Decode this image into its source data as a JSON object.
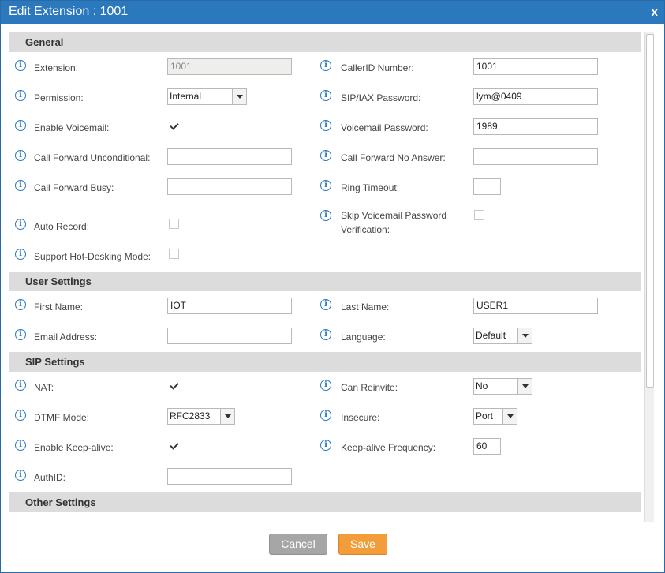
{
  "dialog": {
    "title": "Edit Extension : 1001",
    "close_label": "x"
  },
  "sections": {
    "general": "General",
    "user_settings": "User Settings",
    "sip_settings": "SIP Settings",
    "other_settings": "Other Settings"
  },
  "general": {
    "extension": {
      "label": "Extension:",
      "value": "1001"
    },
    "callerid_number": {
      "label": "CallerID Number:",
      "value": "1001"
    },
    "permission": {
      "label": "Permission:",
      "value": "Internal"
    },
    "sip_iax_password": {
      "label": "SIP/IAX Password:",
      "value": "lym@0409"
    },
    "enable_voicemail": {
      "label": "Enable Voicemail:",
      "checked": true
    },
    "voicemail_password": {
      "label": "Voicemail Password:",
      "value": "1989"
    },
    "cf_unconditional": {
      "label": "Call Forward Unconditional:",
      "value": ""
    },
    "cf_no_answer": {
      "label": "Call Forward No Answer:",
      "value": ""
    },
    "cf_busy": {
      "label": "Call Forward Busy:",
      "value": ""
    },
    "ring_timeout": {
      "label": "Ring Timeout:",
      "value": ""
    },
    "auto_record": {
      "label": "Auto Record:",
      "checked": false
    },
    "skip_vm_pw": {
      "label": "Skip Voicemail Password Verification:",
      "checked": false
    },
    "hot_desking": {
      "label": "Support Hot-Desking Mode:",
      "checked": false
    }
  },
  "user_settings": {
    "first_name": {
      "label": "First Name:",
      "value": "IOT"
    },
    "last_name": {
      "label": "Last Name:",
      "value": "USER1"
    },
    "email": {
      "label": "Email Address:",
      "value": ""
    },
    "language": {
      "label": "Language:",
      "value": "Default"
    }
  },
  "sip_settings": {
    "nat": {
      "label": "NAT:",
      "checked": true
    },
    "can_reinvite": {
      "label": "Can Reinvite:",
      "value": "No"
    },
    "dtmf_mode": {
      "label": "DTMF Mode:",
      "value": "RFC2833"
    },
    "insecure": {
      "label": "Insecure:",
      "value": "Port"
    },
    "keep_alive": {
      "label": "Enable Keep-alive:",
      "checked": true
    },
    "keep_alive_freq": {
      "label": "Keep-alive Frequency:",
      "value": "60"
    },
    "authid": {
      "label": "AuthID:",
      "value": ""
    }
  },
  "buttons": {
    "cancel": "Cancel",
    "save": "Save"
  },
  "colors": {
    "titlebar": "#2b78bd",
    "save": "#f39c3a",
    "cancel": "#a6a6a6",
    "section": "#dcdcdc"
  },
  "icons": {
    "info": "info-icon",
    "info_glyph": "i"
  }
}
